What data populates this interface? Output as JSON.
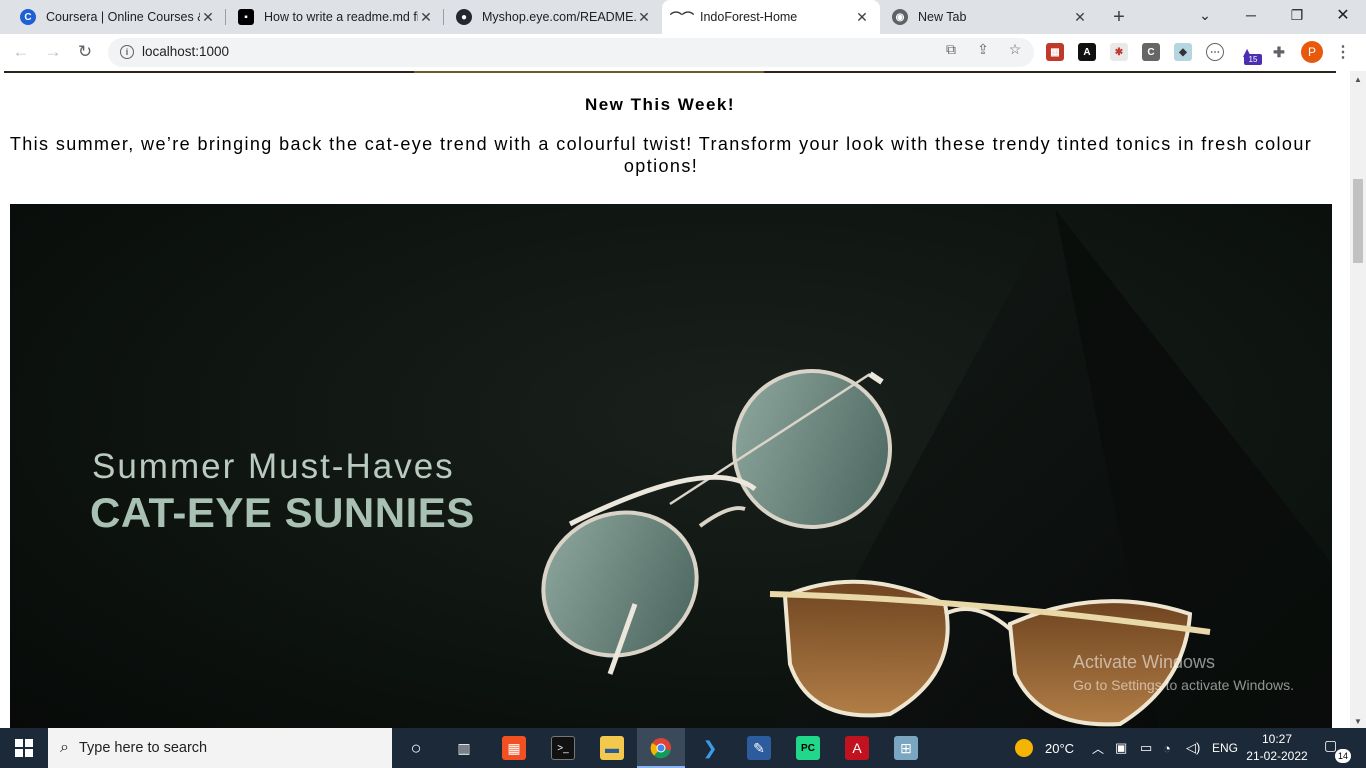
{
  "browser": {
    "tabs": [
      {
        "title": "Coursera | Online Courses &",
        "favicon": "coursera-icon",
        "active": false
      },
      {
        "title": "How to write a readme.md fi",
        "favicon": "dev-icon",
        "active": false
      },
      {
        "title": "Myshop.eye.com/README.m",
        "favicon": "github-icon",
        "active": false
      },
      {
        "title": "IndoForest-Home",
        "favicon": "sunglasses-icon",
        "active": true
      },
      {
        "title": "New Tab",
        "favicon": "chrome-icon",
        "active": false
      }
    ],
    "url": "localhost:1000",
    "profile_initial": "P",
    "extension_badge": "15"
  },
  "page": {
    "headline": "New This Week!",
    "description": "This summer, we’re bringing back the cat-eye trend with a colourful twist! Transform your look with these trendy tinted tonics in fresh colour options!",
    "banner": {
      "subtitle": "Summer Must-Haves",
      "title": "CAT-EYE SUNNIES"
    }
  },
  "watermark": {
    "line1": "Activate Windows",
    "line2": "Go to Settings to activate Windows."
  },
  "taskbar": {
    "search_placeholder": "Type here to search",
    "weather": "20°C",
    "language": "ENG",
    "time": "10:27",
    "date": "21-02-2022",
    "notifications": "14"
  },
  "colors": {
    "tabstrip": "#dee1e6",
    "taskbar": "#1c2938",
    "banner_text": "#a9c0b4"
  }
}
